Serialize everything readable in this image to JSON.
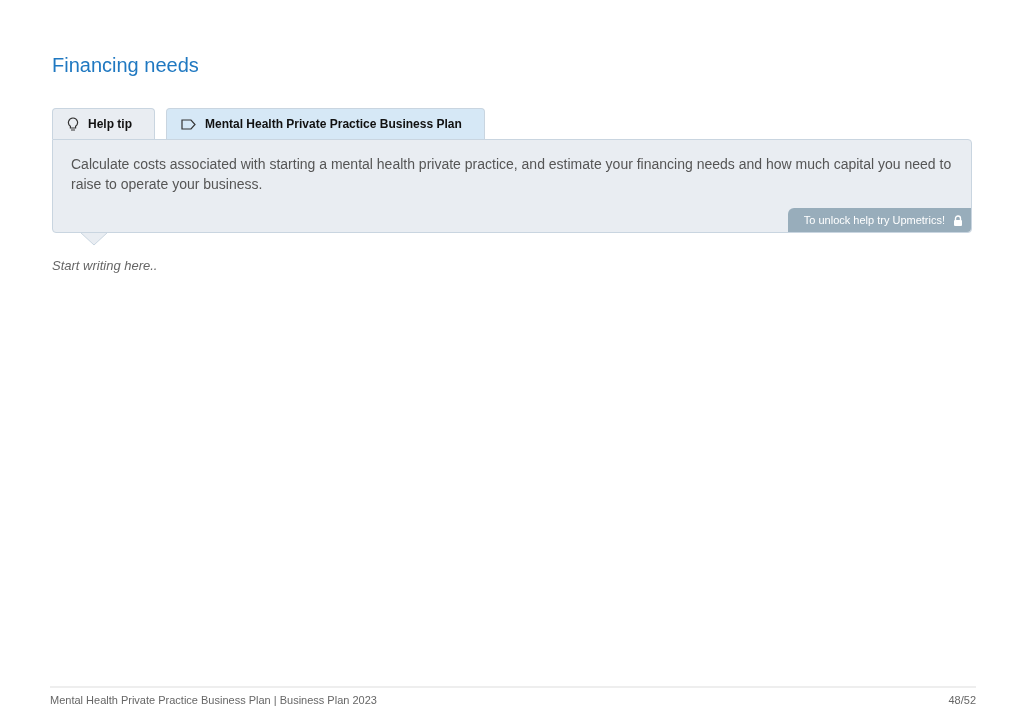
{
  "section": {
    "title": "Financing needs"
  },
  "tabs": [
    {
      "label": "Help tip",
      "kind": "tip",
      "selected": true
    },
    {
      "label": "Mental Health Private Practice Business Plan",
      "kind": "tag",
      "selected": false
    }
  ],
  "tip": {
    "text": "Calculate costs associated with starting a mental health private practice, and estimate your financing needs and how much capital you need to raise to operate your business.",
    "unlock": "To unlock help try Upmetrics!"
  },
  "editor": {
    "placeholder": "Start writing here.."
  },
  "footer": {
    "document": "Mental Health Private Practice Business Plan | Business Plan 2023",
    "page": "48/52"
  }
}
